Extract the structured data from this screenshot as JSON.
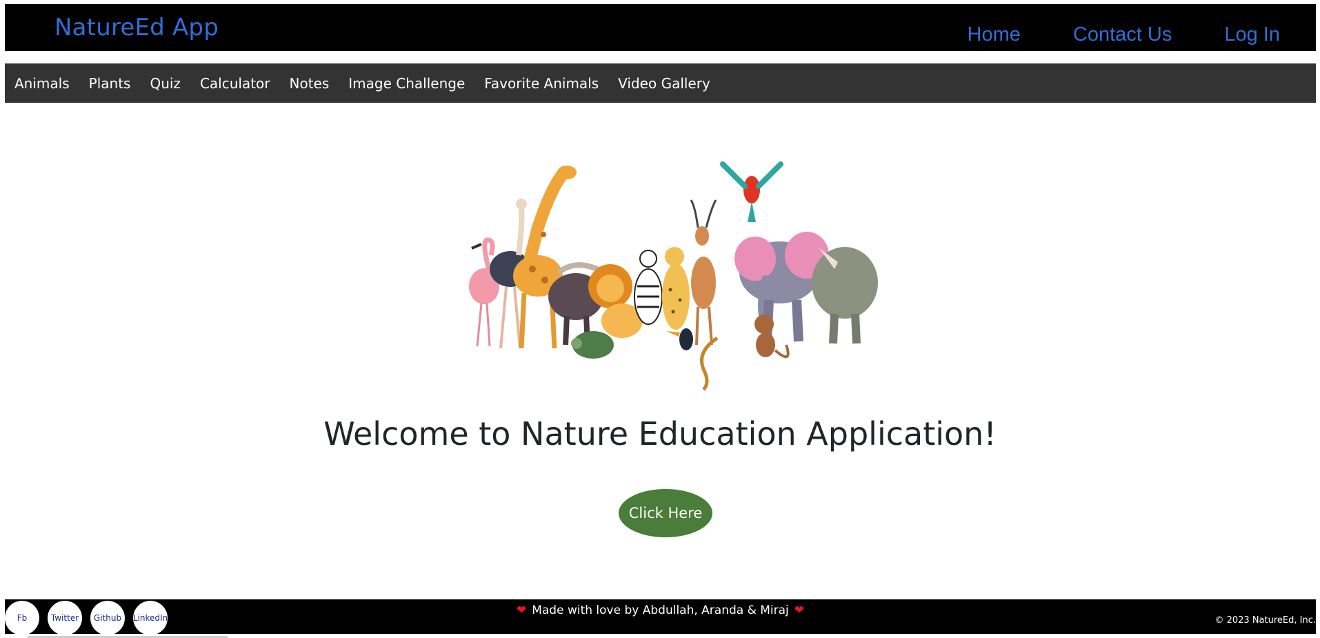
{
  "colors": {
    "brand": "#2f6fd6",
    "topbar_bg": "#000000",
    "navbar_bg": "#333333",
    "cta_bg": "#4a7c3a",
    "heart": "#e0191e"
  },
  "header": {
    "brand": "NatureEd App",
    "links": [
      "Home",
      "Contact Us",
      "Log In"
    ]
  },
  "nav": {
    "items": [
      "Animals",
      "Plants",
      "Quiz",
      "Calculator",
      "Notes",
      "Image Challenge",
      "Favorite Animals",
      "Video Gallery"
    ]
  },
  "main": {
    "hero_image": "animals-group-illustration",
    "heading": "Welcome to Nature Education Application!",
    "cta_label": "Click Here"
  },
  "footer": {
    "socials": [
      "Fb",
      "Twitter",
      "Github",
      "LinkedIn"
    ],
    "message": "Made with love by Abdullah, Aranda & Miraj",
    "heart_icon": "heart-icon",
    "copyright": "© 2023 NatureEd, Inc."
  }
}
